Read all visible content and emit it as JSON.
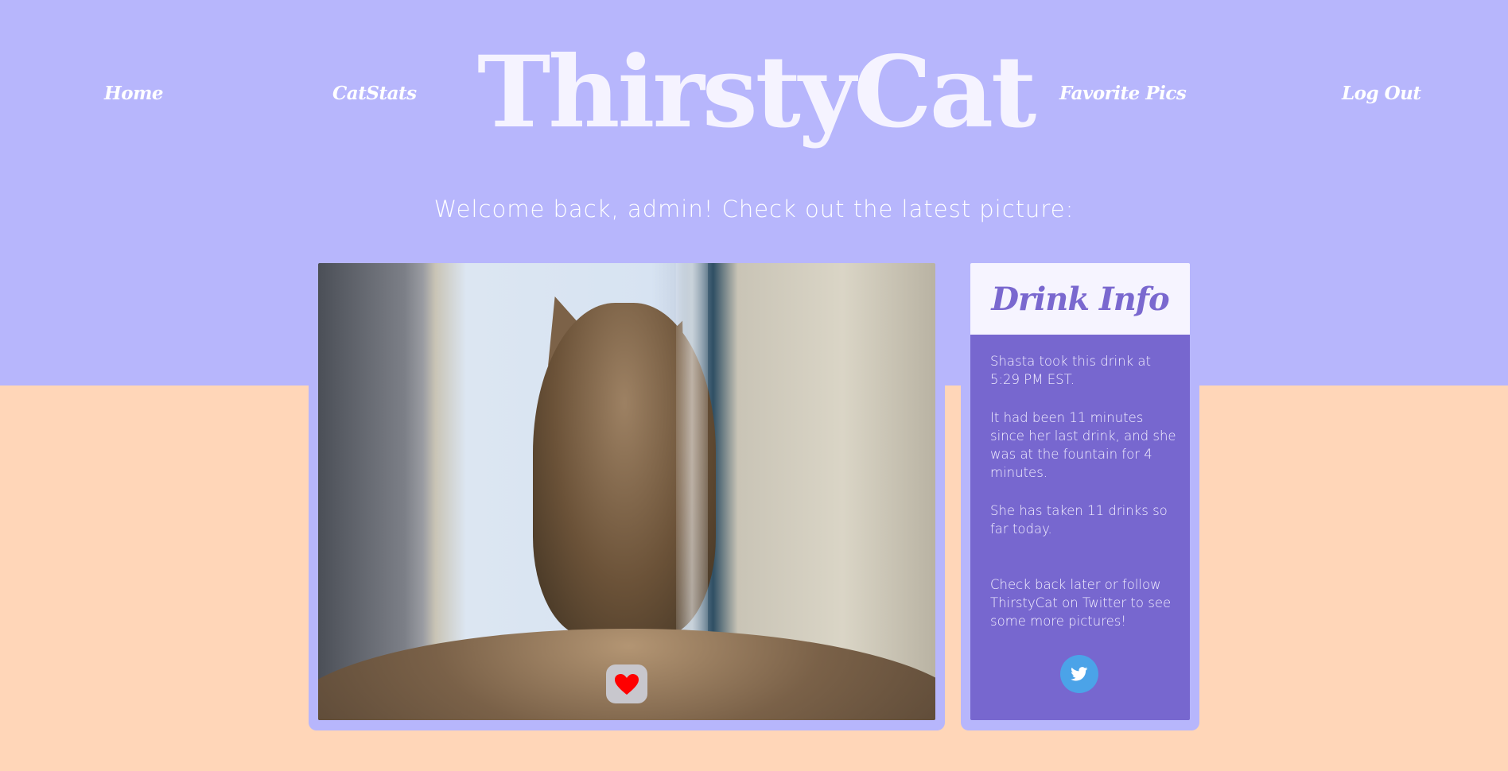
{
  "app": {
    "title": "ThirstyCat"
  },
  "nav": {
    "home": "Home",
    "catstats": "CatStats",
    "favorite_pics": "Favorite Pics",
    "logout": "Log Out"
  },
  "welcome": {
    "message": "Welcome back, admin! Check out the latest picture:"
  },
  "photo": {
    "like_icon": "heart-icon",
    "like_color": "#ff0000"
  },
  "drink_info": {
    "title": "Drink Info",
    "paragraph_1": "Shasta took this drink at 5:29 PM EST.",
    "paragraph_2": "It had been 11 minutes since her last drink, and she was at the fountain for 4 minutes.",
    "paragraph_3": "She has taken 11 drinks so far today.",
    "paragraph_4": "Check back later or follow ThirstyCat on Twitter to see some more pictures!",
    "twitter_icon": "twitter-icon"
  },
  "colors": {
    "top_band": "#b7b6fc",
    "bottom_band": "#ffd6b8",
    "accent_purple": "#7767cf",
    "twitter_blue": "#4ba3e8"
  }
}
